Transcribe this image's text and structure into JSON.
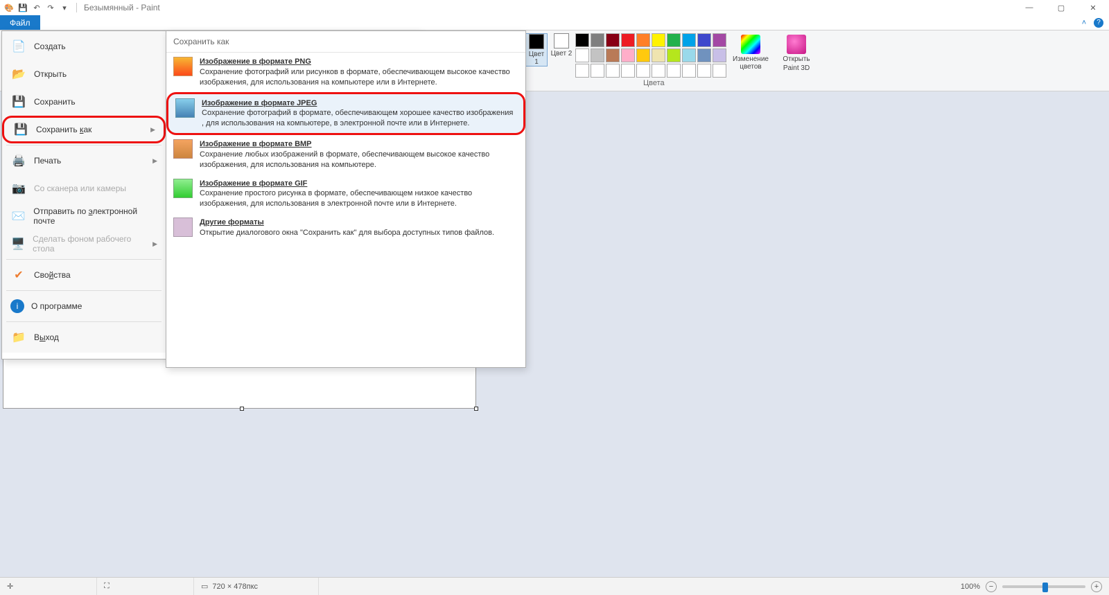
{
  "title": "Безымянный - Paint",
  "tabs": {
    "file": "Файл"
  },
  "ribbon": {
    "color1_label": "Цвет 1",
    "color2_label": "Цвет 2",
    "edit_colors": "Изменение цветов",
    "paint3d_l1": "Открыть",
    "paint3d_l2": "Paint 3D",
    "colors_group": "Цвета",
    "palette_row1": [
      "#000000",
      "#7f7f7f",
      "#880015",
      "#ed1c24",
      "#ff7f27",
      "#fff200",
      "#22b14c",
      "#00a2e8",
      "#3f48cc",
      "#a349a4"
    ],
    "palette_row2": [
      "#ffffff",
      "#c3c3c3",
      "#b97a57",
      "#ffaec9",
      "#ffc90e",
      "#efe4b0",
      "#b5e61d",
      "#99d9ea",
      "#7092be",
      "#c8bfe7"
    ],
    "palette_row3": [
      "#ffffff",
      "#ffffff",
      "#ffffff",
      "#ffffff",
      "#ffffff",
      "#ffffff",
      "#ffffff",
      "#ffffff",
      "#ffffff",
      "#ffffff"
    ]
  },
  "file_menu": {
    "create": "Создать",
    "open": "Открыть",
    "save": "Сохранить",
    "save_as": "Сохранить как",
    "print": "Печать",
    "scanner": "Со сканера или камеры",
    "send_email": "Отправить по электронной почте",
    "wallpaper": "Сделать фоном рабочего стола",
    "properties": "Свойства",
    "about": "О программе",
    "exit": "Выход"
  },
  "save_as_panel": {
    "header": "Сохранить как",
    "png": {
      "title": "Изображение в формате PNG",
      "desc": "Сохранение фотографий или рисунков в формате, обеспечивающем высокое качество изображения, для использования на компьютере или в Интернете."
    },
    "jpeg": {
      "title": "Изображение в формате JPEG",
      "desc": "Сохранение фотографий в формате, обеспечивающем хорошее качество изображения , для использования на компьютере, в электронной почте или в Интернете."
    },
    "bmp": {
      "title": "Изображение в формате BMP",
      "desc": "Сохранение любых изображений в формате, обеспечивающем высокое качество изображения, для использования на компьютере."
    },
    "gif": {
      "title": "Изображение в формате GIF",
      "desc": "Сохранение простого рисунка в формате, обеспечивающем низкое качество изображения, для использования в электронной почте или в Интернете."
    },
    "other": {
      "title": "Другие форматы",
      "desc": "Открытие диалогового окна \"Сохранить как\" для выбора доступных типов файлов."
    }
  },
  "status": {
    "dimensions": "720 × 478пкс",
    "zoom": "100%"
  }
}
